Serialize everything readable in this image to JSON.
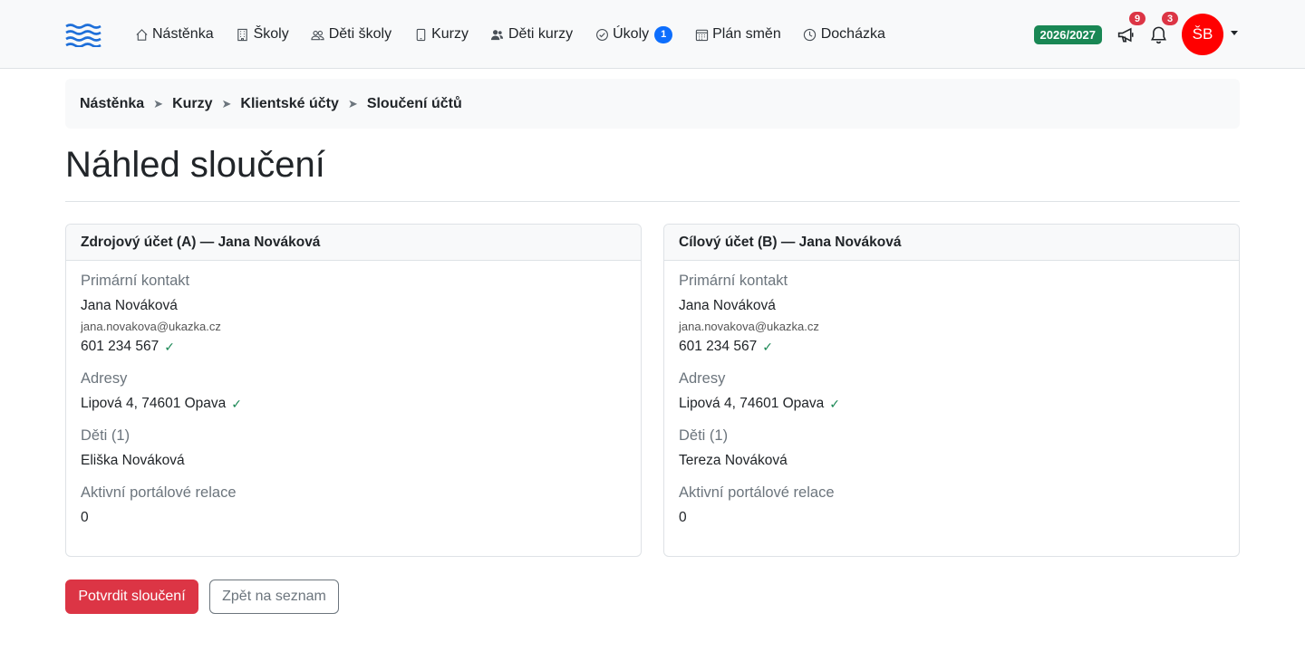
{
  "nav": {
    "items": [
      {
        "label": "Nástěnka",
        "icon": "house-icon"
      },
      {
        "label": "Školy",
        "icon": "building-icon"
      },
      {
        "label": "Děti školy",
        "icon": "people-icon"
      },
      {
        "label": "Kurzy",
        "icon": "tablet-icon"
      },
      {
        "label": "Děti kurzy",
        "icon": "people-fill-icon"
      },
      {
        "label": "Úkoly",
        "icon": "check-circle-icon",
        "badge": "1"
      },
      {
        "label": "Plán směn",
        "icon": "calendar-icon"
      },
      {
        "label": "Docházka",
        "icon": "clock-icon"
      }
    ],
    "year": "2026/2027",
    "announcements_count": "9",
    "notifications_count": "3",
    "avatar_initials": "ŠB"
  },
  "breadcrumb": [
    "Nástěnka",
    "Kurzy",
    "Klientské účty",
    "Sloučení účtů"
  ],
  "page_title": "Náhled sloučení",
  "labels": {
    "primary_contact": "Primární kontakt",
    "addresses": "Adresy",
    "children": "Děti (1)",
    "sessions": "Aktivní portálové relace"
  },
  "source": {
    "header": "Zdrojový účet (A) — Jana Nováková",
    "name": "Jana Nováková",
    "email": "jana.novakova@ukazka.cz",
    "phone": "601 234 567",
    "address": "Lipová 4, 74601 Opava",
    "child": "Eliška Nováková",
    "sessions": "0"
  },
  "target": {
    "header": "Cílový účet (B) — Jana Nováková",
    "name": "Jana Nováková",
    "email": "jana.novakova@ukazka.cz",
    "phone": "601 234 567",
    "address": "Lipová 4, 74601 Opava",
    "child": "Tereza Nováková",
    "sessions": "0"
  },
  "buttons": {
    "confirm": "Potvrdit sloučení",
    "back": "Zpět na seznam"
  },
  "colors": {
    "danger": "#dc3545",
    "success": "#198754",
    "primary": "#0d6efd",
    "avatar": "#ff0000"
  }
}
